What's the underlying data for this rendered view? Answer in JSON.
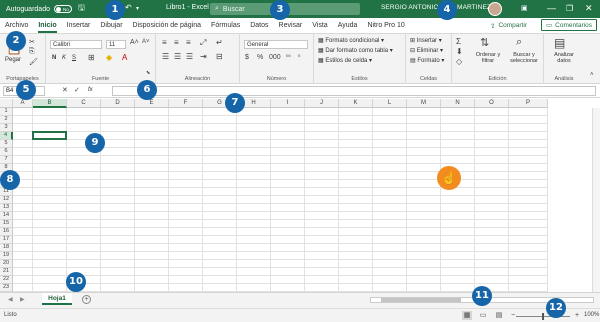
{
  "titlebar": {
    "autosave_label": "Autoguardado",
    "autosave_state": "No",
    "doc_title": "Libro1 - Excel",
    "search_placeholder": "Buscar",
    "username": "SERGIO ANTONIO AL     O MARTINEZ"
  },
  "tabs": [
    "Archivo",
    "Inicio",
    "Insertar",
    "Dibujar",
    "Disposición de página",
    "Fórmulas",
    "Datos",
    "Revisar",
    "Vista",
    "Ayuda",
    "Nitro Pro 10"
  ],
  "active_tab": "Inicio",
  "share_label": "Compartir",
  "comments_label": "Comentarios",
  "ribbon": {
    "clipboard": {
      "paste_label": "Pegar",
      "group_label": "Portapapeles"
    },
    "font": {
      "font_name": "Calibri",
      "font_size": "11",
      "bold": "N",
      "italic": "K",
      "underline": "S",
      "group_label": "Fuente"
    },
    "alignment": {
      "group_label": "Alineación"
    },
    "number": {
      "format": "General",
      "group_label": "Número"
    },
    "styles": {
      "conditional": "Formato condicional",
      "as_table": "Dar formato como tabla",
      "cell_styles": "Estilos de celda",
      "group_label": "Estilos"
    },
    "cells": {
      "insert": "Insertar",
      "delete": "Eliminar",
      "format": "Formato",
      "group_label": "Celdas"
    },
    "editing": {
      "sort": "Ordenar y filtrar",
      "find": "Buscar y seleccionar",
      "group_label": "Edición"
    },
    "analysis": {
      "analyze": "Analizar datos",
      "group_label": "Análisis"
    }
  },
  "formula_bar": {
    "name_box": "B4",
    "fx": "fx"
  },
  "columns": [
    "A",
    "B",
    "C",
    "D",
    "E",
    "F",
    "G",
    "H",
    "I",
    "J",
    "K",
    "L",
    "M",
    "N",
    "O",
    "P"
  ],
  "rows": [
    "1",
    "2",
    "3",
    "4",
    "5",
    "6",
    "7",
    "8",
    "9",
    "10",
    "11",
    "12",
    "13",
    "14",
    "15",
    "16",
    "17",
    "18",
    "19",
    "20",
    "21",
    "22",
    "23"
  ],
  "selected_cell": {
    "column": "B",
    "row": "4"
  },
  "sheet_tab": "Hoja1",
  "status": {
    "text": "Listo",
    "zoom": "100%"
  },
  "callouts": [
    "1",
    "2",
    "3",
    "4",
    "5",
    "6",
    "7",
    "8",
    "9",
    "10",
    "11",
    "12"
  ],
  "colors": {
    "brand": "#217346",
    "callout": "#1565a8",
    "hand": "#f28c1e"
  }
}
